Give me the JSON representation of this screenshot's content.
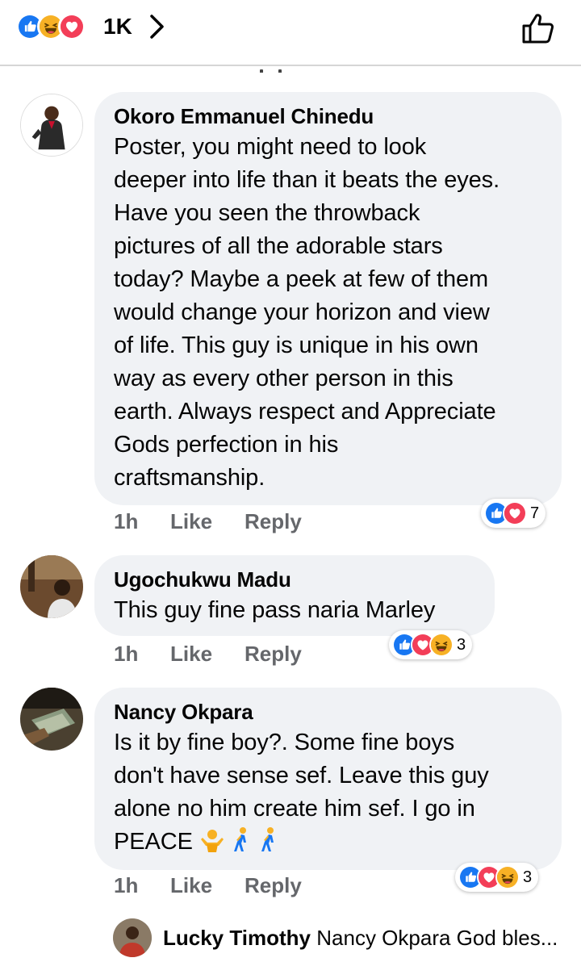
{
  "header": {
    "reaction_count": "1K",
    "reactions": [
      "like-icon",
      "haha-icon",
      "love-icon"
    ]
  },
  "comments": [
    {
      "name": "Okoro Emmanuel Chinedu",
      "lines": [
        "Poster, you might need to look",
        "deeper into life than it beats the eyes.",
        "Have you seen the throwback",
        "pictures of all the adorable stars",
        "today? Maybe a peek at few of them",
        "would change your horizon and view",
        "of life. This guy is unique in his own",
        "way as every other person in this",
        "earth. Always respect and Appreciate",
        "Gods perfection in his",
        "craftsmanship."
      ],
      "time": "1h",
      "like_label": "Like",
      "reply_label": "Reply",
      "reaction_count": "7"
    },
    {
      "name": "Ugochukwu Madu",
      "lines": [
        "This guy fine pass naria Marley"
      ],
      "time": "1h",
      "like_label": "Like",
      "reply_label": "Reply",
      "reaction_count": "3"
    },
    {
      "name": "Nancy Okpara",
      "lines": [
        "Is it by fine boy?. Some fine boys",
        "don't have sense sef. Leave this guy",
        "alone no him create him sef. I go in"
      ],
      "last_line_text": "PEACE",
      "time": "1h",
      "like_label": "Like",
      "reply_label": "Reply",
      "reaction_count": "3"
    }
  ],
  "reply_preview": {
    "name": "Lucky Timothy",
    "text": "Nancy Okpara God bles..."
  },
  "colors": {
    "like_blue": "#1877f2",
    "love_red": "#f33e58",
    "haha_yellow": "#f7b125",
    "bubble_bg": "#f0f2f5",
    "meta_gray": "#65676b"
  }
}
